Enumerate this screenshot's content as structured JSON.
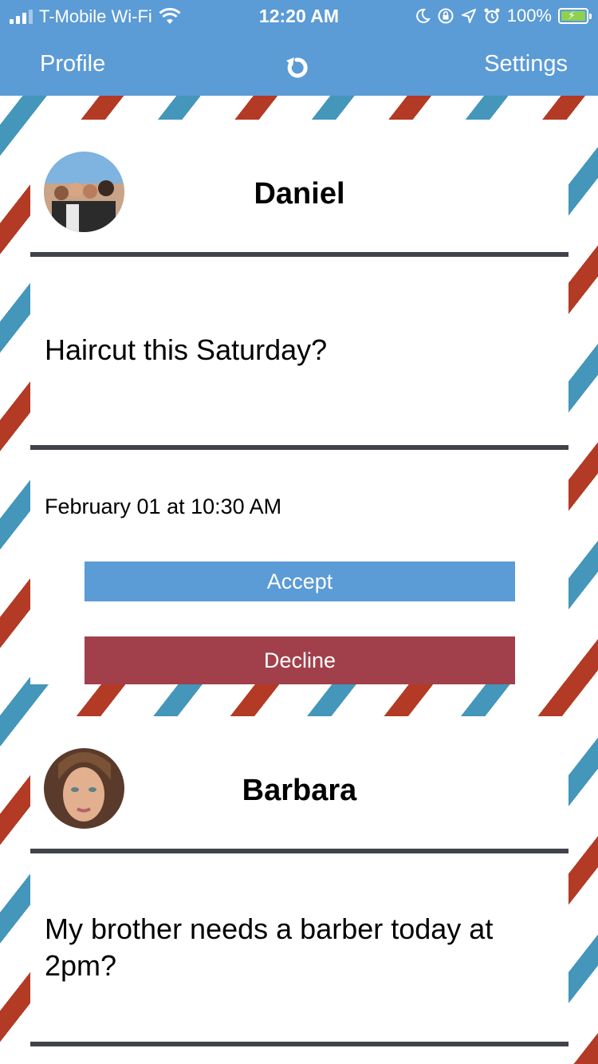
{
  "status_bar": {
    "carrier": "T-Mobile Wi-Fi",
    "time": "12:20 AM",
    "battery": "100%",
    "icons": [
      "signal-icon",
      "wifi-icon",
      "moon-icon",
      "rotation-lock-icon",
      "location-icon",
      "alarm-icon",
      "battery-icon"
    ]
  },
  "nav": {
    "left_label": "Profile",
    "right_label": "Settings",
    "center_icon": "refresh-icon"
  },
  "colors": {
    "nav_bg": "#5b9bd6",
    "stripe_red": "#b33a24",
    "stripe_blue": "#4496ba",
    "accept": "#5b9bd6",
    "decline": "#a1404b",
    "divider": "#404349"
  },
  "requests": [
    {
      "name": "Daniel",
      "message": "Haircut this Saturday?",
      "datetime": "February 01 at 10:30 AM",
      "accept_label": "Accept",
      "decline_label": "Decline"
    },
    {
      "name": "Barbara",
      "message": "My brother needs a barber today at 2pm?"
    }
  ]
}
